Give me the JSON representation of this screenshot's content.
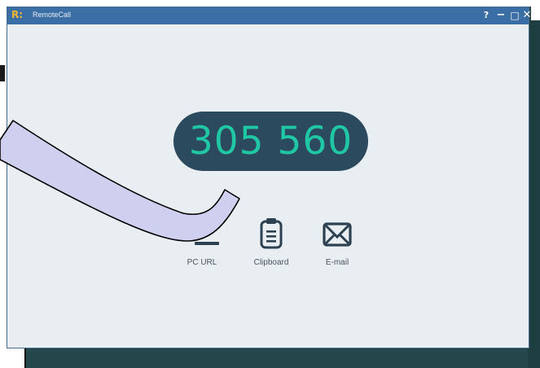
{
  "window": {
    "logo": "R:",
    "title": "RemoteCall",
    "help_label": "?",
    "minimize_label": "−",
    "maximize_label": "□",
    "close_label": "✕"
  },
  "session": {
    "code": "305 560"
  },
  "share_options": [
    {
      "label": "PC URL",
      "icon": "link-icon"
    },
    {
      "label": "Clipboard",
      "icon": "clipboard-icon"
    },
    {
      "label": "E-mail",
      "icon": "envelope-icon"
    }
  ],
  "colors": {
    "titlebar": "#3a6ea5",
    "code_pill": "#2b4a5e",
    "code_text": "#1fc7a5",
    "backdrop": "#24474b",
    "window_bg": "#e9eef2",
    "icon": "#2d4150"
  }
}
